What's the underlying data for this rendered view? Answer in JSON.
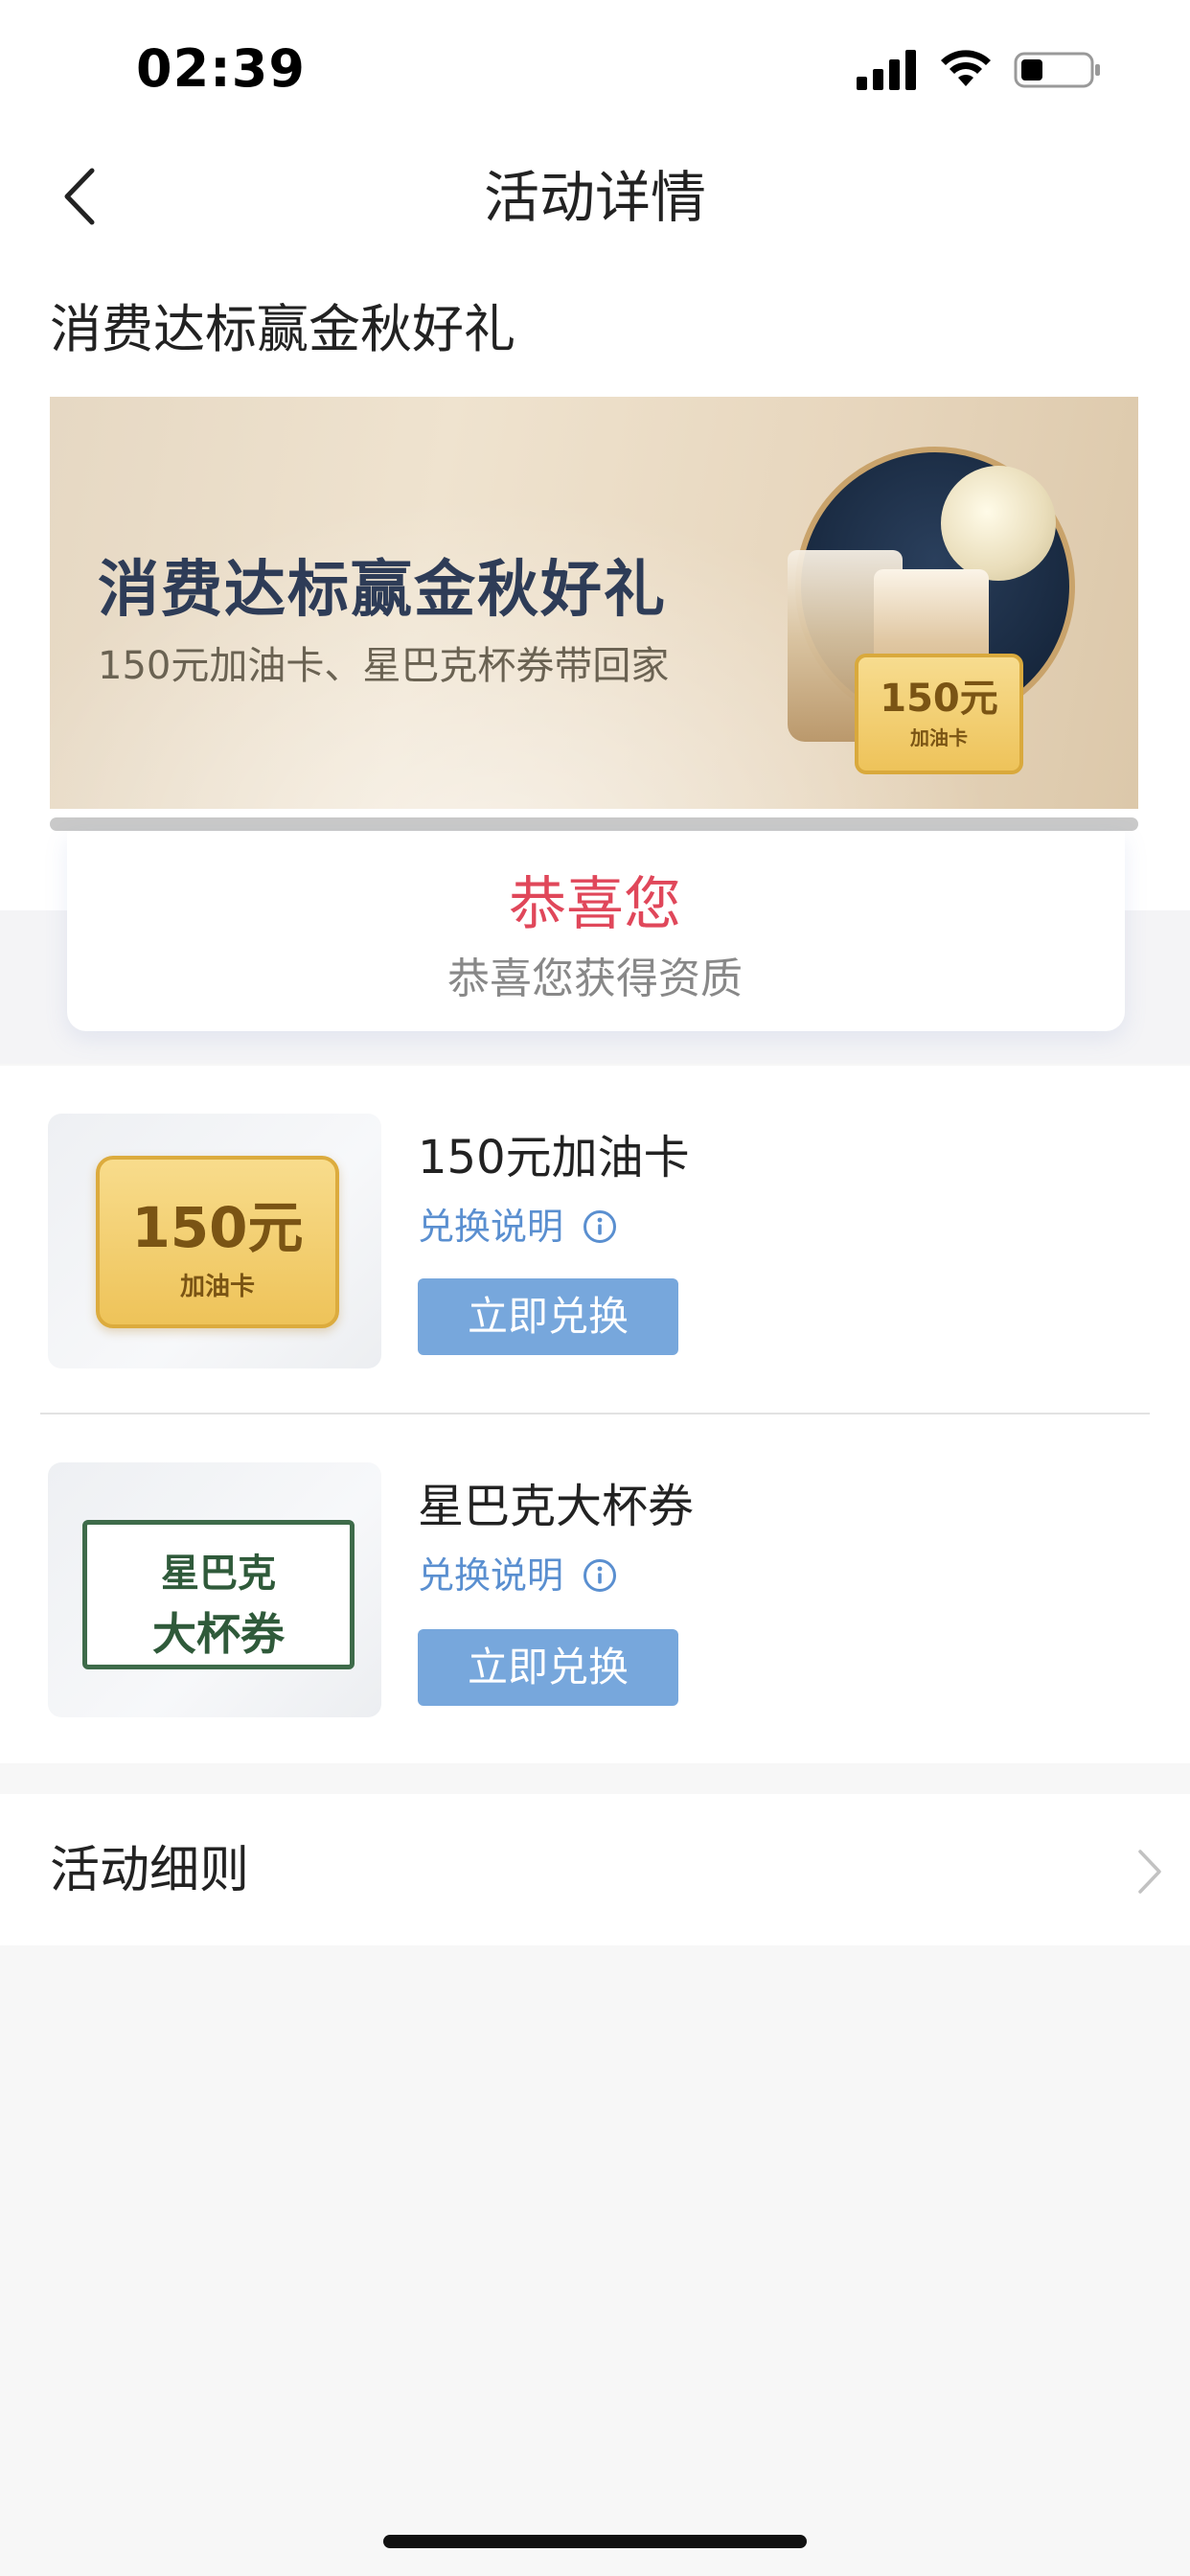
{
  "status_bar": {
    "time": "02:39"
  },
  "nav": {
    "title": "活动详情"
  },
  "activity": {
    "title": "消费达标赢金秋好礼"
  },
  "banner": {
    "headline": "消费达标赢金秋好礼",
    "subtitle": "150元加油卡、星巴克杯券带回家",
    "card_amount": "150元",
    "card_label": "加油卡"
  },
  "congrats": {
    "title": "恭喜您",
    "subtitle": "恭喜您获得资质"
  },
  "rewards": [
    {
      "title": "150元加油卡",
      "howto": "兑换说明",
      "button": "立即兑换",
      "thumb_amount": "150元",
      "thumb_label": "加油卡"
    },
    {
      "title": "星巴克大杯券",
      "howto": "兑换说明",
      "button": "立即兑换",
      "thumb_line1": "星巴克",
      "thumb_line2": "大杯券"
    }
  ],
  "rules": {
    "label": "活动细则"
  },
  "colors": {
    "accent_blue": "#77a7dc",
    "link_blue": "#5a8fd0",
    "congrats_red": "#e0475a"
  }
}
